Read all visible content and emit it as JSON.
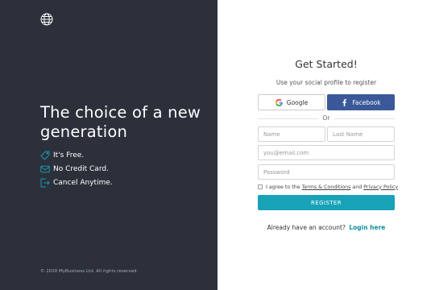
{
  "left": {
    "headline": "The choice of a new generation",
    "features": [
      {
        "icon": "tag-icon",
        "label": "It's Free."
      },
      {
        "icon": "card-icon",
        "label": "No Credit Card."
      },
      {
        "icon": "exit-icon",
        "label": "Cancel Anytime."
      }
    ],
    "copyright": "© 2020 MyBusiness Ltd. All rights reserved."
  },
  "form": {
    "title": "Get Started!",
    "subtitle": "Use your social profile to register",
    "google_label": "Google",
    "facebook_label": "Facebook",
    "or_label": "Or",
    "first_name_placeholder": "Name",
    "last_name_placeholder": "Last Name",
    "email_placeholder": "you@email.com",
    "password_placeholder": "Password",
    "agree_prefix": "I agree to the",
    "terms_link": "Terms & Conditions",
    "agree_and": "and",
    "privacy_link": "Privacy Policy",
    "register_label": "REGISTER",
    "already_text": "Already have an account?",
    "login_link": "Login here"
  },
  "colors": {
    "left_bg": "#2b303b",
    "accent": "#17a2b8",
    "facebook": "#3b5998",
    "feature_icon": "#17a2b8"
  }
}
